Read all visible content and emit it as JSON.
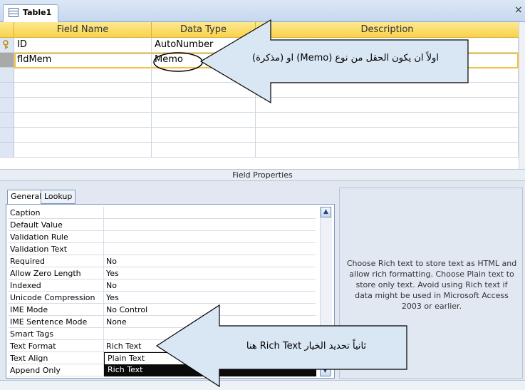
{
  "tab": {
    "label": "Table1",
    "icon": "table-icon",
    "close": "×"
  },
  "grid": {
    "headers": {
      "field_name": "Field Name",
      "data_type": "Data Type",
      "description": "Description"
    },
    "rows": [
      {
        "field_name": "ID",
        "data_type": "AutoNumber",
        "description": "",
        "key": true
      },
      {
        "field_name": "fldMem",
        "data_type": "Memo",
        "description": "",
        "key": false
      }
    ]
  },
  "field_properties_label": "Field Properties",
  "prop_tabs": {
    "general": "General",
    "lookup": "Lookup"
  },
  "properties": [
    {
      "label": "Caption",
      "value": ""
    },
    {
      "label": "Default Value",
      "value": ""
    },
    {
      "label": "Validation Rule",
      "value": ""
    },
    {
      "label": "Validation Text",
      "value": ""
    },
    {
      "label": "Required",
      "value": "No"
    },
    {
      "label": "Allow Zero Length",
      "value": "Yes"
    },
    {
      "label": "Indexed",
      "value": "No"
    },
    {
      "label": "Unicode Compression",
      "value": "Yes"
    },
    {
      "label": "IME Mode",
      "value": "No Control"
    },
    {
      "label": "IME Sentence Mode",
      "value": "None"
    },
    {
      "label": "Smart Tags",
      "value": ""
    },
    {
      "label": "Text Format",
      "value": "Rich Text"
    },
    {
      "label": "Text Align",
      "value": ""
    },
    {
      "label": "Append Only",
      "value": ""
    }
  ],
  "dropdown_options": [
    "Plain Text",
    "Rich Text"
  ],
  "help_text": "Choose Rich text to store text as HTML and allow rich formatting. Choose Plain text to store only text. Avoid using Rich text if data might be used in Microsoft Access 2003 or earlier.",
  "annotations": {
    "first": "اولاً ان يكون الحقل من نوع (Memo) او (مذكرة)",
    "second": "ثانياً تحديد الخيار  Rich Text هنا"
  },
  "colors": {
    "header_gold": "#f9d24a",
    "highlight": "#f2c23c",
    "panel": "#e1e8f2",
    "arrow_fill": "#d9e6f4"
  }
}
